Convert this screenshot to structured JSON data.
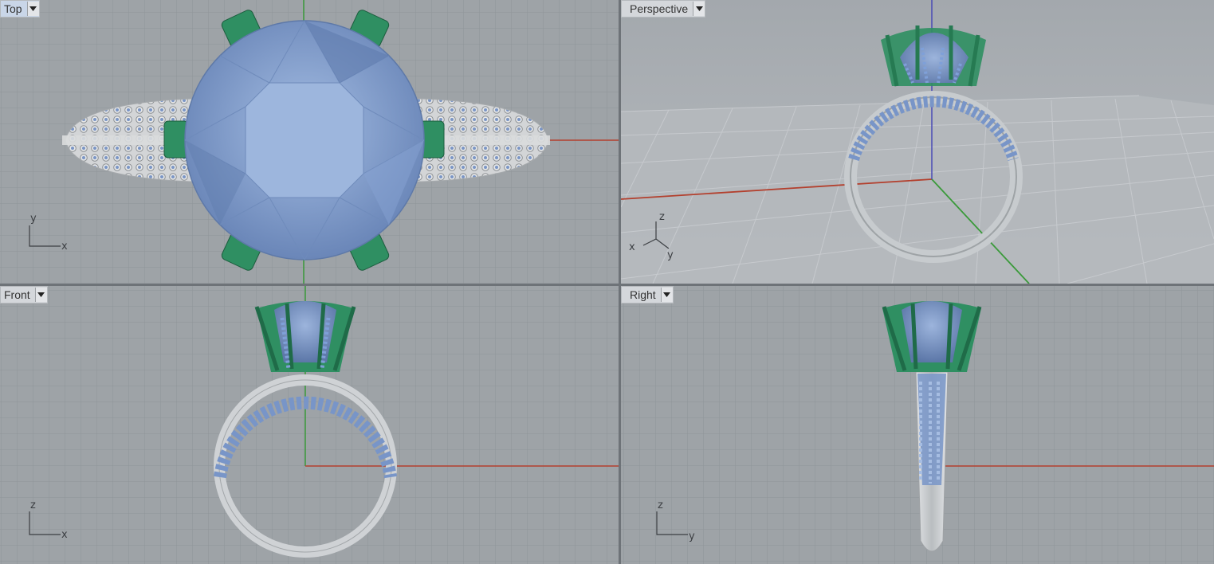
{
  "viewports": {
    "top": {
      "label": "Top",
      "axis_h": "x",
      "axis_v": "y"
    },
    "perspective": {
      "label": "Perspective",
      "axis_x": "x",
      "axis_y": "y",
      "axis_z": "z"
    },
    "front": {
      "label": "Front",
      "axis_h": "x",
      "axis_v": "z"
    },
    "right": {
      "label": "Right",
      "axis_h": "y",
      "axis_v": "z"
    }
  },
  "colors": {
    "viewport_bg": "#9ea3a7",
    "grid_minor": "#8d9296",
    "grid_major": "#7f8489",
    "axis_x": "#b3402e",
    "axis_y": "#3a9a3a",
    "axis_z": "#4a4ab5",
    "gem": "#7f9ccc",
    "prong": "#2f8f62",
    "metal": "#c9cdd0",
    "pave": "#6e8fc9"
  },
  "icons": {
    "viewport_menu": "dropdown-triangle-icon",
    "axis_widget": "axis-gizmo-icon"
  }
}
